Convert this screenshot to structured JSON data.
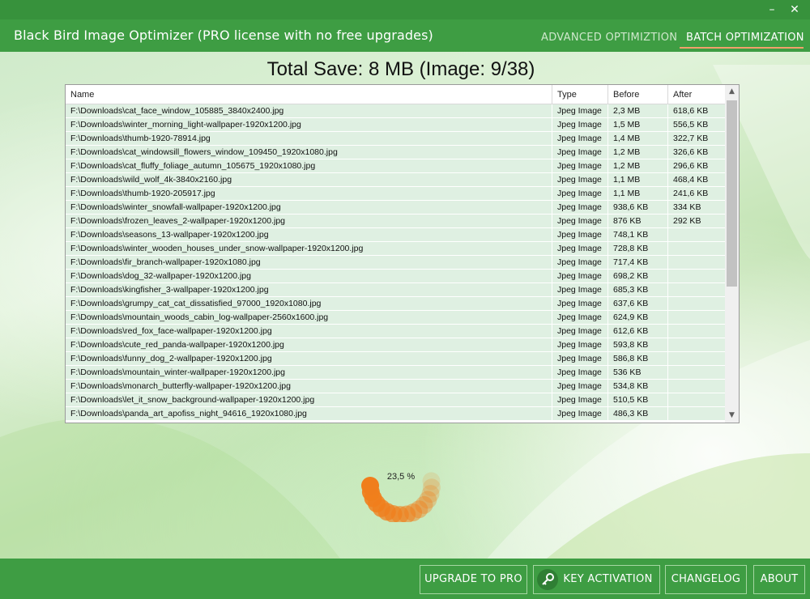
{
  "window": {
    "title": "Black Bird Image Optimizer (PRO license with no free upgrades)",
    "minimize_icon": "minimize-icon",
    "close_icon": "close-icon"
  },
  "nav": {
    "tabs": [
      {
        "label": "ADVANCED OPTIMIZTION",
        "active": false
      },
      {
        "label": "BATCH OPTIMIZATION",
        "active": true
      }
    ]
  },
  "summary": {
    "total_save": "Total Save: 8 MB (Image: 9/38)"
  },
  "table": {
    "columns": [
      "Name",
      "Type",
      "Before",
      "After"
    ],
    "rows": [
      {
        "name": "F:\\Downloads\\cat_face_window_105885_3840x2400.jpg",
        "type": "Jpeg Image",
        "before": "2,3 MB",
        "after": "618,6 KB"
      },
      {
        "name": "F:\\Downloads\\winter_morning_light-wallpaper-1920x1200.jpg",
        "type": "Jpeg Image",
        "before": "1,5 MB",
        "after": "556,5 KB"
      },
      {
        "name": "F:\\Downloads\\thumb-1920-78914.jpg",
        "type": "Jpeg Image",
        "before": "1,4 MB",
        "after": "322,7 KB"
      },
      {
        "name": "F:\\Downloads\\cat_windowsill_flowers_window_109450_1920x1080.jpg",
        "type": "Jpeg Image",
        "before": "1,2 MB",
        "after": "326,6 KB"
      },
      {
        "name": "F:\\Downloads\\cat_fluffy_foliage_autumn_105675_1920x1080.jpg",
        "type": "Jpeg Image",
        "before": "1,2 MB",
        "after": "296,6 KB"
      },
      {
        "name": "F:\\Downloads\\wild_wolf_4k-3840x2160.jpg",
        "type": "Jpeg Image",
        "before": "1,1 MB",
        "after": "468,4 KB"
      },
      {
        "name": "F:\\Downloads\\thumb-1920-205917.jpg",
        "type": "Jpeg Image",
        "before": "1,1 MB",
        "after": "241,6 KB"
      },
      {
        "name": "F:\\Downloads\\winter_snowfall-wallpaper-1920x1200.jpg",
        "type": "Jpeg Image",
        "before": "938,6 KB",
        "after": "334 KB"
      },
      {
        "name": "F:\\Downloads\\frozen_leaves_2-wallpaper-1920x1200.jpg",
        "type": "Jpeg Image",
        "before": "876 KB",
        "after": "292 KB"
      },
      {
        "name": "F:\\Downloads\\seasons_13-wallpaper-1920x1200.jpg",
        "type": "Jpeg Image",
        "before": "748,1 KB",
        "after": ""
      },
      {
        "name": "F:\\Downloads\\winter_wooden_houses_under_snow-wallpaper-1920x1200.jpg",
        "type": "Jpeg Image",
        "before": "728,8 KB",
        "after": ""
      },
      {
        "name": "F:\\Downloads\\fir_branch-wallpaper-1920x1080.jpg",
        "type": "Jpeg Image",
        "before": "717,4 KB",
        "after": ""
      },
      {
        "name": "F:\\Downloads\\dog_32-wallpaper-1920x1200.jpg",
        "type": "Jpeg Image",
        "before": "698,2 KB",
        "after": ""
      },
      {
        "name": "F:\\Downloads\\kingfisher_3-wallpaper-1920x1200.jpg",
        "type": "Jpeg Image",
        "before": "685,3 KB",
        "after": ""
      },
      {
        "name": "F:\\Downloads\\grumpy_cat_cat_dissatisfied_97000_1920x1080.jpg",
        "type": "Jpeg Image",
        "before": "637,6 KB",
        "after": ""
      },
      {
        "name": "F:\\Downloads\\mountain_woods_cabin_log-wallpaper-2560x1600.jpg",
        "type": "Jpeg Image",
        "before": "624,9 KB",
        "after": ""
      },
      {
        "name": "F:\\Downloads\\red_fox_face-wallpaper-1920x1200.jpg",
        "type": "Jpeg Image",
        "before": "612,6 KB",
        "after": ""
      },
      {
        "name": "F:\\Downloads\\cute_red_panda-wallpaper-1920x1200.jpg",
        "type": "Jpeg Image",
        "before": "593,8 KB",
        "after": ""
      },
      {
        "name": "F:\\Downloads\\funny_dog_2-wallpaper-1920x1200.jpg",
        "type": "Jpeg Image",
        "before": "586,8 KB",
        "after": ""
      },
      {
        "name": "F:\\Downloads\\mountain_winter-wallpaper-1920x1200.jpg",
        "type": "Jpeg Image",
        "before": "536 KB",
        "after": ""
      },
      {
        "name": "F:\\Downloads\\monarch_butterfly-wallpaper-1920x1200.jpg",
        "type": "Jpeg Image",
        "before": "534,8 KB",
        "after": ""
      },
      {
        "name": "F:\\Downloads\\let_it_snow_background-wallpaper-1920x1200.jpg",
        "type": "Jpeg Image",
        "before": "510,5 KB",
        "after": ""
      },
      {
        "name": "F:\\Downloads\\panda_art_apofiss_night_94616_1920x1080.jpg",
        "type": "Jpeg Image",
        "before": "486,3 KB",
        "after": ""
      }
    ]
  },
  "progress": {
    "label": "23,5 %",
    "value": 0.235,
    "color": "#f07e1c"
  },
  "footer": {
    "upgrade_label": "UPGRADE TO PRO",
    "key_label": "KEY ACTIVATION",
    "key_icon": "key-icon",
    "changelog_label": "CHANGELOG",
    "about_label": "ABOUT"
  },
  "colors": {
    "bar_green": "#3e9d43",
    "accent_orange": "#f2a06b",
    "row_fill": "#dff0e2"
  }
}
